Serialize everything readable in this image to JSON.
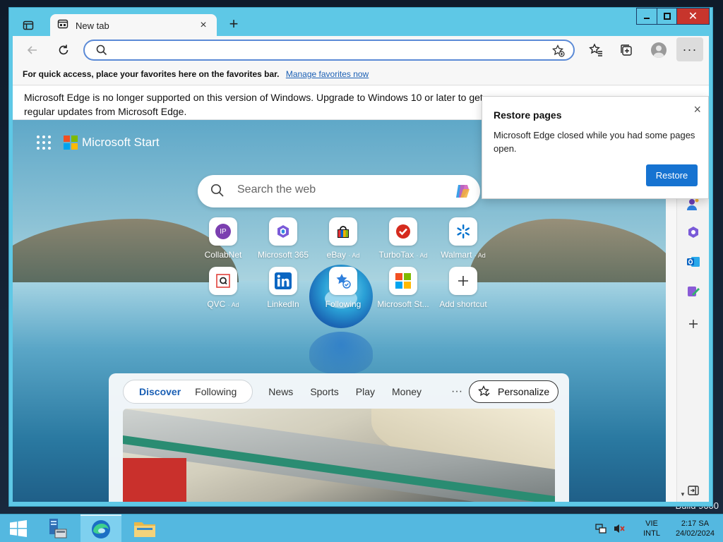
{
  "desktop": {
    "build_text": "Build 9600"
  },
  "browser": {
    "tab": {
      "title": "New tab",
      "close": "×"
    },
    "new_tab_button": "+",
    "window_controls": {
      "minimize": "▁",
      "maximize": "□",
      "close": "✕"
    },
    "address_bar": {
      "value": "",
      "placeholder": ""
    },
    "more_button": "···"
  },
  "favorites_bar": {
    "message": "For quick access, place your favorites here on the favorites bar.",
    "link": "Manage favorites now"
  },
  "infobar": {
    "text": "Microsoft Edge is no longer supported on this version of Windows. Upgrade to Windows 10 or later to get regular updates from Microsoft Edge."
  },
  "new_tab_page": {
    "brand": "Microsoft Start",
    "search": {
      "placeholder": "Search the web"
    },
    "tiles": [
      {
        "label": "CollabNet",
        "ad": "",
        "icon": "collabnet-icon"
      },
      {
        "label": "Microsoft 365",
        "ad": "",
        "icon": "microsoft365-icon"
      },
      {
        "label": "eBay",
        "ad": "· Ad",
        "icon": "ebay-icon"
      },
      {
        "label": "TurboTax",
        "ad": "· Ad",
        "icon": "turbotax-icon"
      },
      {
        "label": "Walmart",
        "ad": "· Ad",
        "icon": "walmart-icon"
      },
      {
        "label": "QVC",
        "ad": "· Ad",
        "icon": "qvc-icon"
      },
      {
        "label": "LinkedIn",
        "ad": "",
        "icon": "linkedin-icon"
      },
      {
        "label": "Following",
        "ad": "",
        "icon": "following-icon"
      },
      {
        "label": "Microsoft St...",
        "ad": "",
        "icon": "microsoft-start-icon"
      },
      {
        "label": "Add shortcut",
        "ad": "",
        "icon": "plus-icon"
      }
    ],
    "collabnet_initials": "IP",
    "feed": {
      "tabs": [
        "Discover",
        "Following"
      ],
      "categories": [
        "News",
        "Sports",
        "Play",
        "Money"
      ],
      "more": "···",
      "personalize": "Personalize"
    }
  },
  "restore_popup": {
    "title": "Restore pages",
    "body": "Microsoft Edge closed while you had some pages open.",
    "button": "Restore",
    "close": "×"
  },
  "taskbar": {
    "language": {
      "line1": "VIE",
      "line2": "INTL"
    },
    "time": "2:17 SA",
    "date": "24/02/2024"
  },
  "colors": {
    "window_frame": "#5ec8e6",
    "taskbar": "#54b8e0",
    "accent": "#1673d1",
    "close_red": "#c7352c"
  }
}
